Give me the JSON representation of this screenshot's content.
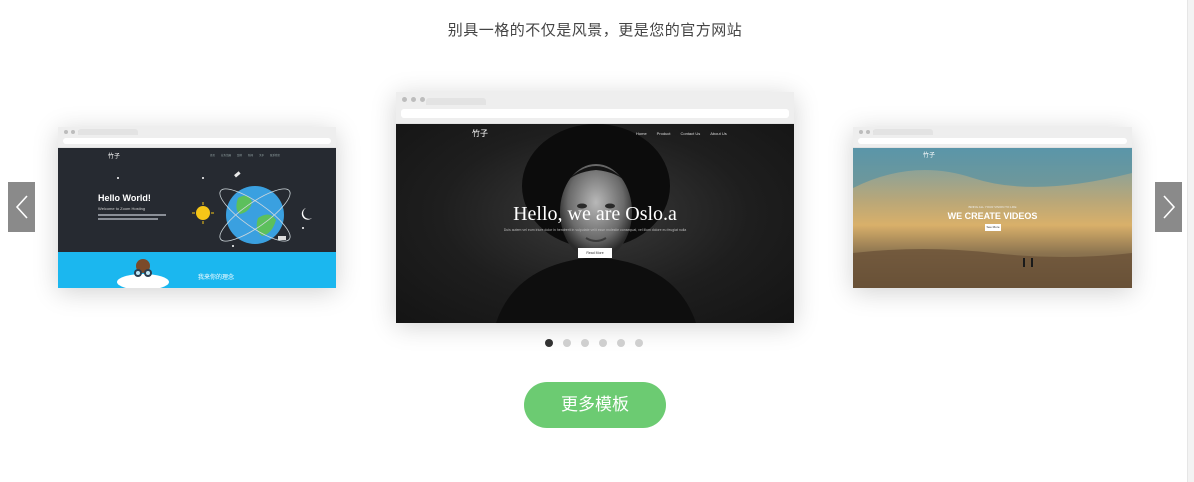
{
  "subtitle": "别具一格的不仅是风景，更是您的官方网站",
  "carousel": {
    "left": {
      "logo": "竹子",
      "nav": [
        "首页",
        "业务范围",
        "案例",
        "新闻",
        "关于",
        "联系我们"
      ],
      "hero_title": "Hello World!",
      "hero_sub": "Welcome to Zoom Hosting",
      "band_title": "我来你的理念"
    },
    "center": {
      "logo": "竹子",
      "nav": [
        "Home",
        "Product",
        "Contact Us",
        "About Us"
      ],
      "hero_title": "Hello, we are Oslo.a",
      "hero_sub": "Duis autem vel eum iriure dolor in hendrerit in vulputate velit esse molestie consequat, vel illum dolore eu feugiat nulla",
      "button": "Read More"
    },
    "right": {
      "logo": "竹子",
      "hero_kicker": "BRING ALL YOUR VISION TO LIFE",
      "hero_title": "WE CREATE VIDEOS",
      "button": "See More"
    }
  },
  "arrows": {
    "prev_icon": "chevron-left-icon",
    "next_icon": "chevron-right-icon"
  },
  "pagination": {
    "count": 6,
    "active": 0
  },
  "more_button": "更多模板",
  "colors": {
    "accent": "#6ccb72",
    "arrow_bg": "#8a8a8a",
    "dot_active": "#333333",
    "dot_inactive": "#cfcfcf"
  }
}
